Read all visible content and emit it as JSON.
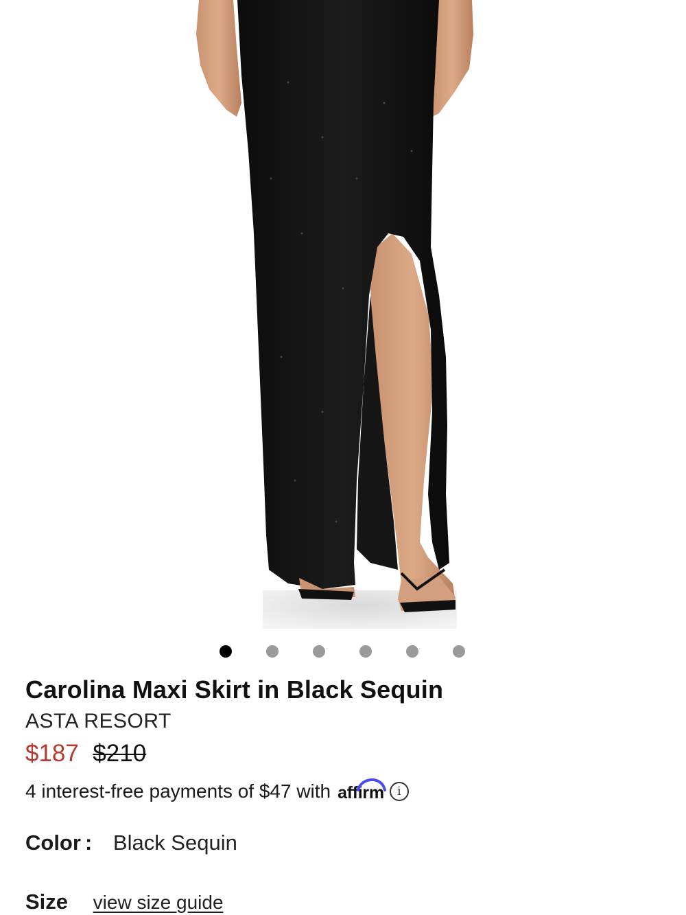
{
  "product": {
    "title": "Carolina Maxi Skirt in Black Sequin",
    "brand": "ASTA RESORT",
    "price_sale": "$187",
    "price_original": "$210",
    "sale_color": "#b33a2e"
  },
  "gallery": {
    "total_images": 6,
    "active_index": 0
  },
  "affirm": {
    "text": "4 interest-free payments of $47 with",
    "logo_text": "affirm",
    "info_icon": "info-icon"
  },
  "color": {
    "label": "Color",
    "colon": ":",
    "value": "Black Sequin"
  },
  "size": {
    "label": "Size",
    "guide_link": "view size guide"
  }
}
